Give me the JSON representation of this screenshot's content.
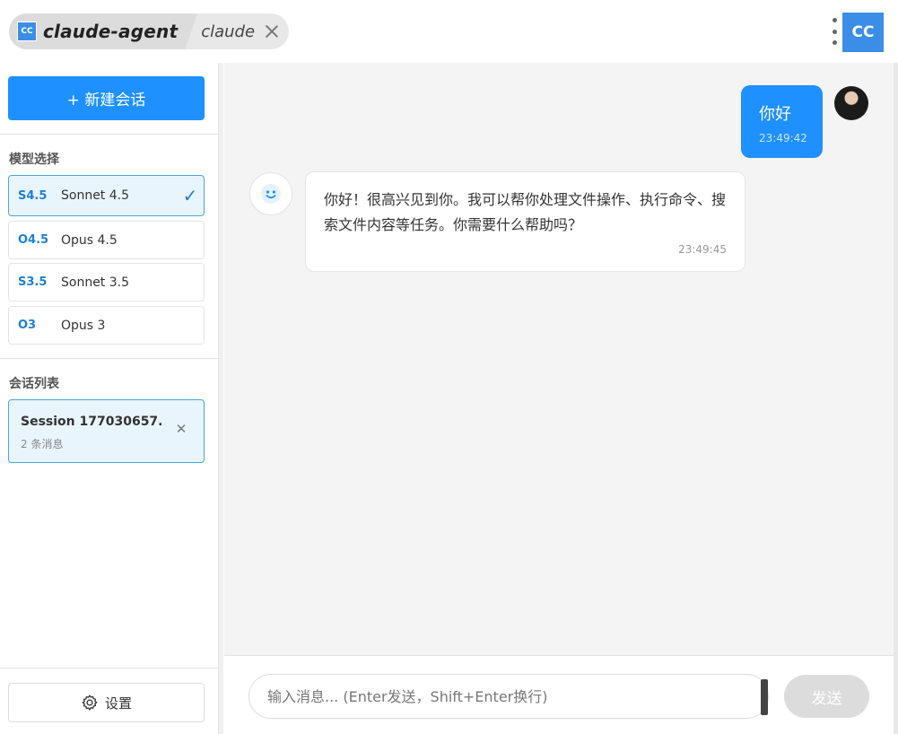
{
  "topbar": {
    "logo_text": "CC",
    "active_tab_title": "claude-agent",
    "second_tab_title": "claude",
    "user_badge": "CC"
  },
  "sidebar": {
    "new_chat_label": "+ 新建会话",
    "model_section_label": "模型选择",
    "models": [
      {
        "badge": "S4.5",
        "name": "Sonnet 4.5",
        "selected": true
      },
      {
        "badge": "O4.5",
        "name": "Opus 4.5",
        "selected": false
      },
      {
        "badge": "S3.5",
        "name": "Sonnet 3.5",
        "selected": false
      },
      {
        "badge": "O3",
        "name": "Opus 3",
        "selected": false
      }
    ],
    "session_section_label": "会话列表",
    "sessions": [
      {
        "title": "Session 177030657...",
        "subtitle": "2 条消息"
      }
    ],
    "settings_label": "设置"
  },
  "chat": {
    "messages": [
      {
        "role": "user",
        "text": "你好",
        "time": "23:49:42"
      },
      {
        "role": "assistant",
        "text": "你好！很高兴见到你。我可以帮你处理文件操作、执行命令、搜索文件内容等任务。你需要什么帮助吗？",
        "time": "23:49:45"
      }
    ]
  },
  "composer": {
    "placeholder": "输入消息... (Enter发送，Shift+Enter换行)",
    "value": "",
    "send_label": "发送"
  },
  "colors": {
    "accent": "#1e90ff",
    "logo": "#3a8ee6",
    "active_card_bg": "#e8f5fc",
    "active_card_border": "#4aa6d9",
    "chat_bg": "#f4f4f4",
    "send_disabled": "#dcdcdc"
  },
  "icons": {
    "close": "close-icon",
    "check": "check-icon",
    "gear": "gear-icon",
    "bot": "smile-icon",
    "menu": "kebab-menu-icon"
  }
}
